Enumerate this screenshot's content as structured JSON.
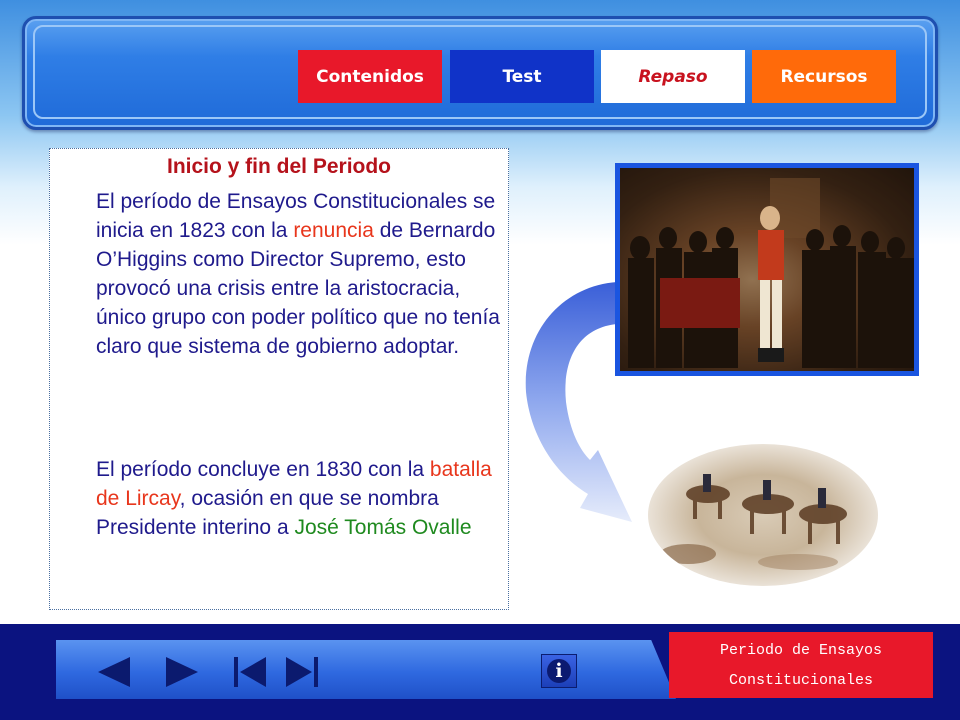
{
  "nav_tabs": [
    {
      "label": "Contenidos"
    },
    {
      "label": "Test"
    },
    {
      "label": "Repaso"
    },
    {
      "label": "Recursos"
    }
  ],
  "content": {
    "title": "Inicio y fin del Periodo",
    "para1_a": "El período de Ensayos Constitucionales se inicia en 1823 con la ",
    "para1_link": "renuncia",
    "para1_b": " de Bernardo O’Higgins como Director Supremo, esto provocó una crisis entre la aristocracia, único grupo con poder político que no tenía claro que sistema de gobierno adoptar.",
    "para2_a": "El período concluye en 1830 con la ",
    "para2_link": "batalla de Lircay",
    "para2_b": ", ocasión en que se nombra Presidente interino a ",
    "para2_name": "José Tomás Ovalle"
  },
  "footer": {
    "title_line1": "Periodo de Ensayos",
    "title_line2": "Constitucionales",
    "info_label": "i"
  },
  "colors": {
    "tab_contenidos": "#e8182a",
    "tab_test": "#1033c8",
    "tab_repaso": "#ffffff",
    "tab_recursos": "#ff6a0a",
    "footer_bg": "#0b1380"
  },
  "icons": [
    "previous-icon",
    "next-icon",
    "first-icon",
    "last-icon",
    "info-icon"
  ]
}
